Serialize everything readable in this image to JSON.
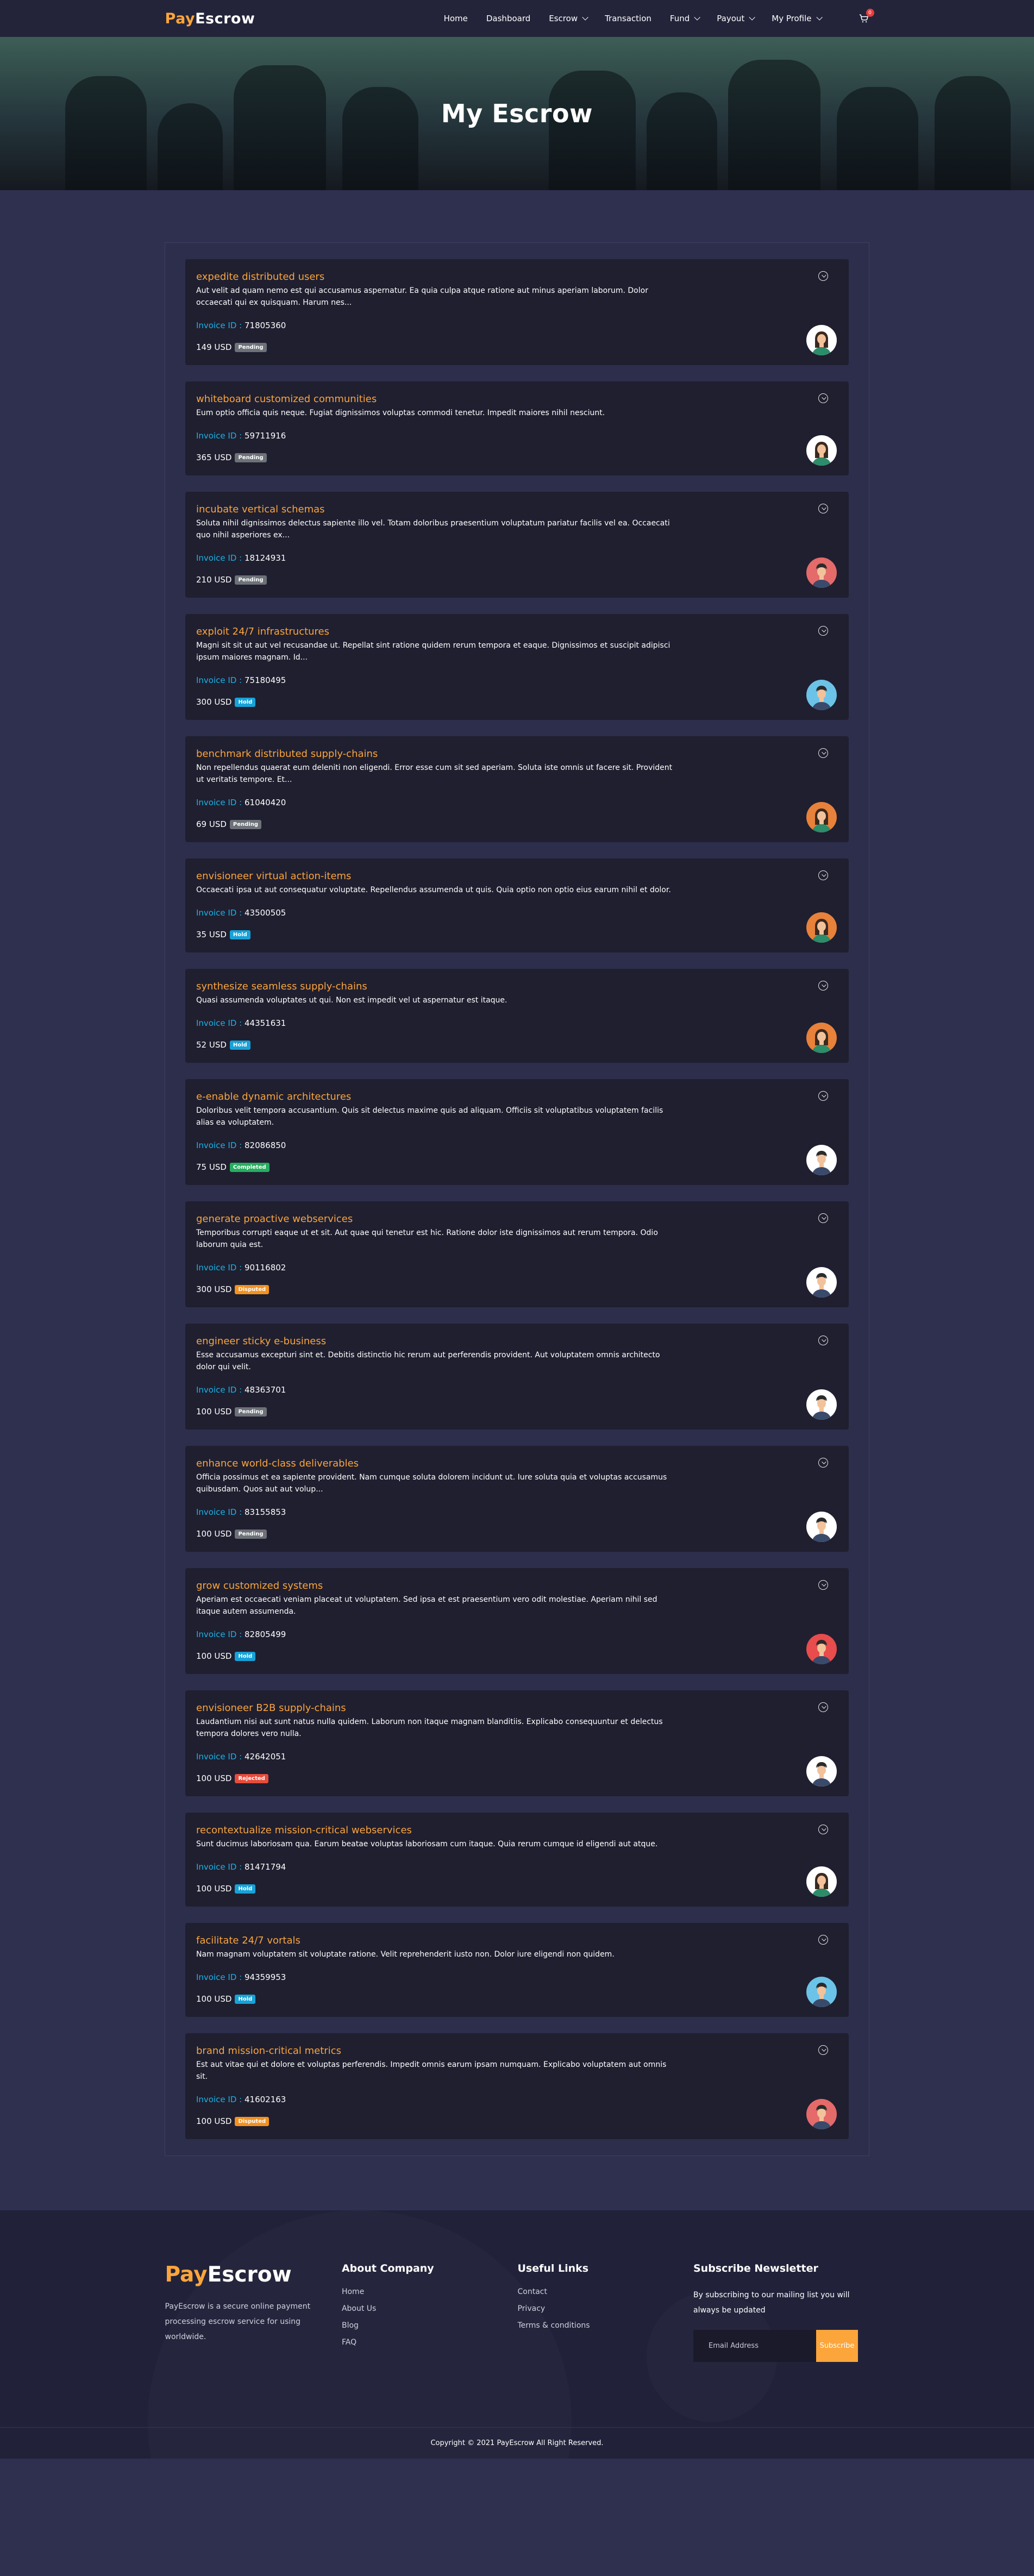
{
  "brand": {
    "pay": "Pay",
    "escrow": "Escrow"
  },
  "nav": {
    "items": [
      {
        "label": "Home",
        "dropdown": false
      },
      {
        "label": "Dashboard",
        "dropdown": false
      },
      {
        "label": "Escrow",
        "dropdown": true
      },
      {
        "label": "Transaction",
        "dropdown": false
      },
      {
        "label": "Fund",
        "dropdown": true
      },
      {
        "label": "Payout",
        "dropdown": true
      },
      {
        "label": "My Profile",
        "dropdown": true
      }
    ],
    "cart_count": "0",
    "cart_icon": "cart-icon"
  },
  "hero": {
    "title": "My Escrow"
  },
  "invoice_label": "Invoice ID :",
  "cards": [
    {
      "title": "expedite distributed users",
      "desc": "Aut velit ad quam nemo est qui accusamus aspernatur. Ea quia culpa atque ratione aut minus aperiam laborum. Dolor occaecati qui ex quisquam. Harum nes...",
      "invoice": "71805360",
      "amount": "149 USD",
      "status": "Pending",
      "status_class": "pending",
      "avatar": "woman-avatar",
      "avatar_bg": "#ffffff"
    },
    {
      "title": "whiteboard customized communities",
      "desc": "Eum optio officia quis neque. Fugiat dignissimos voluptas commodi tenetur. Impedit maiores nihil nesciunt.",
      "invoice": "59711916",
      "amount": "365 USD",
      "status": "Pending",
      "status_class": "pending",
      "avatar": "woman-avatar",
      "avatar_bg": "#ffffff"
    },
    {
      "title": "incubate vertical schemas",
      "desc": "Soluta nihil dignissimos delectus sapiente illo vel. Totam doloribus praesentium voluptatum pariatur facilis vel ea. Occaecati quo nihil asperiores ex...",
      "invoice": "18124931",
      "amount": "210 USD",
      "status": "Pending",
      "status_class": "pending",
      "avatar": "man-avatar",
      "avatar_bg": "#e56a6a"
    },
    {
      "title": "exploit 24/7 infrastructures",
      "desc": "Magni sit sit ut aut vel recusandae ut. Repellat sint ratione quidem rerum tempora et eaque. Dignissimos et suscipit adipisci ipsum maiores magnam. Id...",
      "invoice": "75180495",
      "amount": "300 USD",
      "status": "Hold",
      "status_class": "hold",
      "avatar": "man-avatar",
      "avatar_bg": "#6cc3e8"
    },
    {
      "title": "benchmark distributed supply-chains",
      "desc": "Non repellendus quaerat eum deleniti non eligendi. Error esse cum sit sed aperiam. Soluta iste omnis ut facere sit. Provident ut veritatis tempore. Et...",
      "invoice": "61040420",
      "amount": "69 USD",
      "status": "Pending",
      "status_class": "pending",
      "avatar": "woman-avatar",
      "avatar_bg": "#e8813a"
    },
    {
      "title": "envisioneer virtual action-items",
      "desc": "Occaecati ipsa ut aut consequatur voluptate. Repellendus assumenda ut quis. Quia optio non optio eius earum nihil et dolor.",
      "invoice": "43500505",
      "amount": "35 USD",
      "status": "Hold",
      "status_class": "hold",
      "avatar": "woman-avatar",
      "avatar_bg": "#e8813a"
    },
    {
      "title": "synthesize seamless supply-chains",
      "desc": "Quasi assumenda voluptates ut qui. Non est impedit vel ut aspernatur est itaque.",
      "invoice": "44351631",
      "amount": "52 USD",
      "status": "Hold",
      "status_class": "hold",
      "avatar": "woman-avatar",
      "avatar_bg": "#e8813a"
    },
    {
      "title": "e-enable dynamic architectures",
      "desc": "Doloribus velit tempora accusantium. Quis sit delectus maxime quis ad aliquam. Officiis sit voluptatibus voluptatem facilis alias ea voluptatem.",
      "invoice": "82086850",
      "amount": "75 USD",
      "status": "Completed",
      "status_class": "completed",
      "avatar": "man-avatar",
      "avatar_bg": "#ffffff"
    },
    {
      "title": "generate proactive webservices",
      "desc": "Temporibus corrupti eaque ut et sit. Aut quae qui tenetur est hic. Ratione dolor iste dignissimos aut rerum tempora. Odio laborum quia est.",
      "invoice": "90116802",
      "amount": "300 USD",
      "status": "Disputed",
      "status_class": "disputed",
      "avatar": "man-avatar",
      "avatar_bg": "#ffffff"
    },
    {
      "title": "engineer sticky e-business",
      "desc": "Esse accusamus excepturi sint et. Debitis distinctio hic rerum aut perferendis provident. Aut voluptatem omnis architecto dolor qui velit.",
      "invoice": "48363701",
      "amount": "100 USD",
      "status": "Pending",
      "status_class": "pending",
      "avatar": "man-avatar",
      "avatar_bg": "#ffffff"
    },
    {
      "title": "enhance world-class deliverables",
      "desc": "Officia possimus et ea sapiente provident. Nam cumque soluta dolorem incidunt ut. Iure soluta quia et voluptas accusamus quibusdam. Quos aut aut volup...",
      "invoice": "83155853",
      "amount": "100 USD",
      "status": "Pending",
      "status_class": "pending",
      "avatar": "man-avatar",
      "avatar_bg": "#ffffff"
    },
    {
      "title": "grow customized systems",
      "desc": "Aperiam est occaecati veniam placeat ut voluptatem. Sed ipsa et est praesentium vero odit molestiae. Aperiam nihil sed itaque autem assumenda.",
      "invoice": "82805499",
      "amount": "100 USD",
      "status": "Hold",
      "status_class": "hold",
      "avatar": "man-avatar",
      "avatar_bg": "#e84c4c"
    },
    {
      "title": "envisioneer B2B supply-chains",
      "desc": "Laudantium nisi aut sunt natus nulla quidem. Laborum non itaque magnam blanditiis. Explicabo consequuntur et delectus tempora dolores vero nulla.",
      "invoice": "42642051",
      "amount": "100 USD",
      "status": "Rejected",
      "status_class": "rejected",
      "avatar": "man-avatar",
      "avatar_bg": "#ffffff"
    },
    {
      "title": "recontextualize mission-critical webservices",
      "desc": "Sunt ducimus laboriosam qua. Earum beatae voluptas laboriosam cum itaque. Quia rerum cumque id eligendi aut atque.",
      "invoice": "81471794",
      "amount": "100 USD",
      "status": "Hold",
      "status_class": "hold",
      "avatar": "woman-avatar",
      "avatar_bg": "#ffffff"
    },
    {
      "title": "facilitate 24/7 vortals",
      "desc": "Nam magnam voluptatem sit voluptate ratione. Velit reprehenderit iusto non. Dolor iure eligendi non quidem.",
      "invoice": "94359953",
      "amount": "100 USD",
      "status": "Hold",
      "status_class": "hold",
      "avatar": "man-avatar",
      "avatar_bg": "#6cc3e8"
    },
    {
      "title": "brand mission-critical metrics",
      "desc": "Est aut vitae qui et dolore et voluptas perferendis. Impedit omnis earum ipsam numquam. Explicabo voluptatem aut omnis sit.",
      "invoice": "41602163",
      "amount": "100 USD",
      "status": "Disputed",
      "status_class": "disputed",
      "avatar": "man-avatar",
      "avatar_bg": "#e56a6a"
    }
  ],
  "footer": {
    "brand_desc": "PayEscrow is a secure online payment processing  escrow service for using worldwide.",
    "about": {
      "heading": "About Company",
      "links": [
        "Home",
        "About Us",
        "Blog",
        "FAQ"
      ]
    },
    "useful": {
      "heading": "Useful Links",
      "links": [
        "Contact",
        "Privacy",
        "Terms & conditions"
      ]
    },
    "newsletter": {
      "heading": "Subscribe Newsletter",
      "desc": "By subscribing to our mailing list you will always be updated",
      "placeholder": "Email Address",
      "button": "Subscribe"
    },
    "copyright": "Copyright © 2021 PayEscrow All Right Reserved."
  },
  "colors": {
    "accent": "#fca53b",
    "link": "#1ab3e6",
    "bg": "#2f3050",
    "card": "#1f1f30"
  }
}
